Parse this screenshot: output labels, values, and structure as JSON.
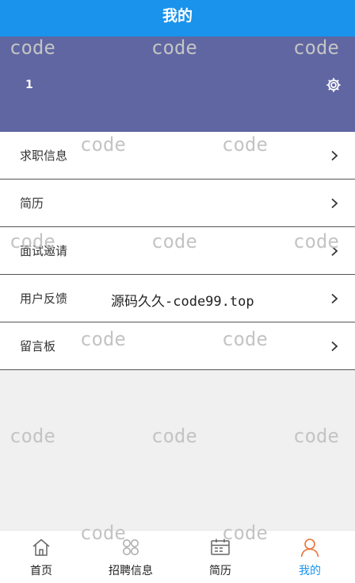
{
  "header": {
    "title": "我的"
  },
  "profile": {
    "username": "1"
  },
  "menu": {
    "items": [
      {
        "label": "求职信息"
      },
      {
        "label": "简历"
      },
      {
        "label": "面试邀请"
      },
      {
        "label": "用户反馈"
      },
      {
        "label": "留言板"
      }
    ]
  },
  "tabbar": {
    "tabs": [
      {
        "label": "首页",
        "icon": "home-icon"
      },
      {
        "label": "招聘信息",
        "icon": "grid-icon"
      },
      {
        "label": "简历",
        "icon": "resume-icon"
      },
      {
        "label": "我的",
        "icon": "user-icon"
      }
    ],
    "active_color": "#1a93ec"
  },
  "watermark": {
    "word": "code",
    "center_text": "源码久久-code99.top"
  },
  "colors": {
    "header": "#1a93ec",
    "profile_bg": "#5f66a2",
    "page_bg": "#f0f0f0"
  }
}
